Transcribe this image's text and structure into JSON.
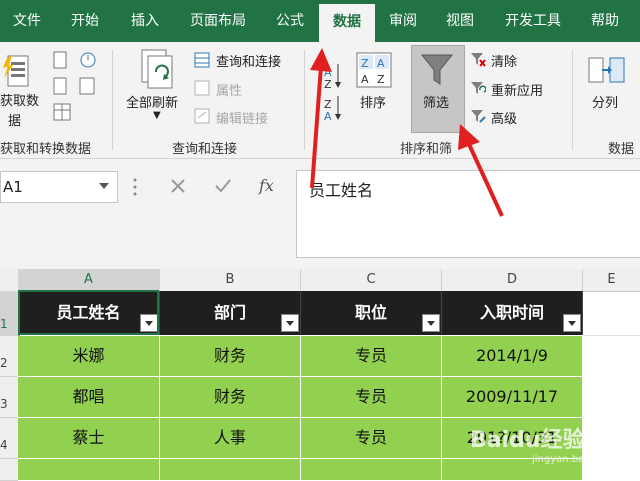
{
  "tabs": [
    "文件",
    "开始",
    "插入",
    "页面布局",
    "公式",
    "数据",
    "审阅",
    "视图",
    "开发工具",
    "帮助"
  ],
  "active_tab": "数据",
  "ribbon": {
    "get_data_label_1": "获取数",
    "get_data_label_2": "据",
    "get_data_group": "获取和转换数据",
    "refresh_all_label": "全部刷新",
    "query_connections": "查询和连接",
    "properties": "属性",
    "edit_links": "编辑链接",
    "query_group": "查询和连接",
    "sort_label": "排序",
    "filter_label": "筛选",
    "clear_label": "清除",
    "reapply_label": "重新应用",
    "advanced_label": "高级",
    "sort_filter_group": "排序和筛",
    "split_label": "分列",
    "data_tools_group": "数据"
  },
  "formula_bar": {
    "name_box": "A1",
    "fx": "fx",
    "content": "员工姓名"
  },
  "grid": {
    "columns": [
      "A",
      "B",
      "C",
      "D",
      "E"
    ],
    "rows": [
      "1",
      "2",
      "3",
      "4"
    ],
    "headers": [
      "员工姓名",
      "部门",
      "职位",
      "入职时间"
    ],
    "data": [
      [
        "米娜",
        "财务",
        "专员",
        "2014/1/9"
      ],
      [
        "都唱",
        "财务",
        "专员",
        "2009/11/17"
      ],
      [
        "蔡士",
        "人事",
        "专员",
        "201?/10/31"
      ]
    ]
  },
  "watermark": {
    "brand": "Baidu经验",
    "url": "jingyan.baidu.com"
  },
  "colors": {
    "excel_green": "#217346",
    "header_fill": "#1f1f1f",
    "data_fill": "#92d050",
    "arrow_red": "#e02020"
  }
}
